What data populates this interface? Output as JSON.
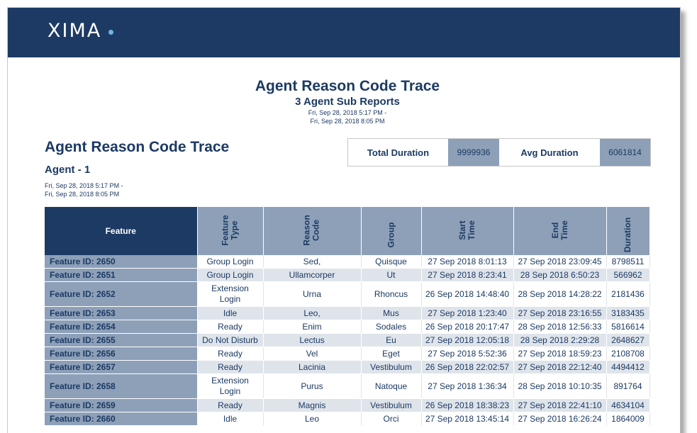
{
  "header": {
    "logo_text": "XIMA",
    "brand_color": "#1c3a63",
    "accent_color": "#6fb5e8"
  },
  "report": {
    "title": "Agent Reason Code Trace",
    "subtitle": "3 Agent Sub Reports",
    "date_range_line1": "Fri, Sep 28, 2018 5:17 PM -",
    "date_range_line2": "Fri, Sep 28, 2018 8:05 PM"
  },
  "section": {
    "title": "Agent Reason Code Trace",
    "agent_label": "Agent - 1",
    "date_line1": "Fri, Sep 28, 2018 5:17 PM -",
    "date_line2": "Fri, Sep 28, 2018 8:05 PM"
  },
  "summary": {
    "total_label": "Total Duration",
    "total_value": "9999936",
    "avg_label": "Avg Duration",
    "avg_value": "6061814"
  },
  "table": {
    "headers": {
      "feature": "Feature",
      "feature_type_1": "Feature",
      "feature_type_2": "Type",
      "reason_code_1": "Reason",
      "reason_code_2": "Code",
      "group": "Group",
      "start_time_1": "Start",
      "start_time_2": "Time",
      "end_time_1": "End",
      "end_time_2": "Time",
      "duration": "Duration"
    },
    "rows": [
      {
        "feature": "Feature ID: 2650",
        "type1": "Group Login",
        "type2": "",
        "reason": "Sed,",
        "group": "Quisque",
        "start": "27 Sep 2018 8:01:13",
        "end": "27 Sep 2018 23:09:45",
        "duration": "8798511"
      },
      {
        "feature": "Feature ID: 2651",
        "type1": "Group Login",
        "type2": "",
        "reason": "Ullamcorper",
        "group": "Ut",
        "start": "27 Sep 2018 8:23:41",
        "end": "28 Sep 2018 6:50:23",
        "duration": "566962"
      },
      {
        "feature": "Feature ID: 2652",
        "type1": "Extension",
        "type2": "Login",
        "reason": "Urna",
        "group": "Rhoncus",
        "start": "26 Sep 2018 14:48:40",
        "end": "28 Sep 2018 14:28:22",
        "duration": "2181436"
      },
      {
        "feature": "Feature ID: 2653",
        "type1": "Idle",
        "type2": "",
        "reason": "Leo,",
        "group": "Mus",
        "start": "27 Sep 2018 1:23:40",
        "end": "27 Sep 2018 23:16:55",
        "duration": "3183435"
      },
      {
        "feature": "Feature ID: 2654",
        "type1": "Ready",
        "type2": "",
        "reason": "Enim",
        "group": "Sodales",
        "start": "26 Sep 2018 20:17:47",
        "end": "28 Sep 2018 12:56:33",
        "duration": "5816614"
      },
      {
        "feature": "Feature ID: 2655",
        "type1": "Do Not Disturb",
        "type2": "",
        "reason": "Lectus",
        "group": "Eu",
        "start": "27 Sep 2018 12:05:18",
        "end": "28 Sep 2018 2:29:28",
        "duration": "2648627"
      },
      {
        "feature": "Feature ID: 2656",
        "type1": "Ready",
        "type2": "",
        "reason": "Vel",
        "group": "Eget",
        "start": "27 Sep 2018 5:52:36",
        "end": "27 Sep 2018 18:59:23",
        "duration": "2108708"
      },
      {
        "feature": "Feature ID: 2657",
        "type1": "Ready",
        "type2": "",
        "reason": "Lacinia",
        "group": "Vestibulum",
        "start": "26 Sep 2018 22:02:57",
        "end": "27 Sep 2018 22:12:40",
        "duration": "4494412"
      },
      {
        "feature": "Feature ID: 2658",
        "type1": "Extension",
        "type2": "Login",
        "reason": "Purus",
        "group": "Natoque",
        "start": "27 Sep 2018 1:36:34",
        "end": "28 Sep 2018 10:10:35",
        "duration": "891764"
      },
      {
        "feature": "Feature ID: 2659",
        "type1": "Ready",
        "type2": "",
        "reason": "Magnis",
        "group": "Vestibulum",
        "start": "26 Sep 2018 18:38:23",
        "end": "27 Sep 2018 22:41:10",
        "duration": "4634104"
      },
      {
        "feature": "Feature ID: 2660",
        "type1": "Idle",
        "type2": "",
        "reason": "Leo",
        "group": "Orci",
        "start": "27 Sep 2018 13:45:14",
        "end": "27 Sep 2018 16:26:24",
        "duration": "1864009"
      }
    ]
  }
}
